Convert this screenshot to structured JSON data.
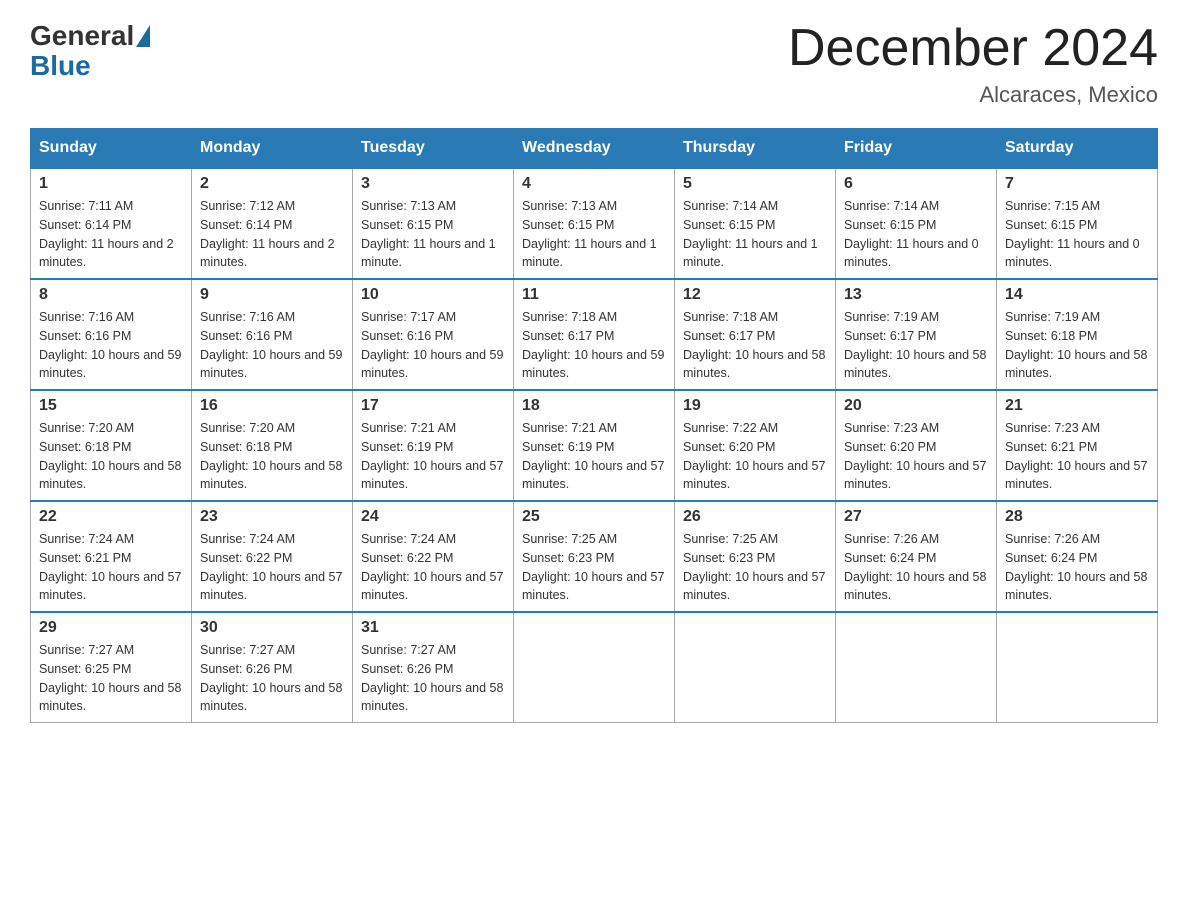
{
  "header": {
    "logo_general": "General",
    "logo_blue": "Blue",
    "month_title": "December 2024",
    "location": "Alcaraces, Mexico"
  },
  "days_of_week": [
    "Sunday",
    "Monday",
    "Tuesday",
    "Wednesday",
    "Thursday",
    "Friday",
    "Saturday"
  ],
  "weeks": [
    [
      {
        "day": "1",
        "sunrise": "7:11 AM",
        "sunset": "6:14 PM",
        "daylight": "11 hours and 2 minutes."
      },
      {
        "day": "2",
        "sunrise": "7:12 AM",
        "sunset": "6:14 PM",
        "daylight": "11 hours and 2 minutes."
      },
      {
        "day": "3",
        "sunrise": "7:13 AM",
        "sunset": "6:15 PM",
        "daylight": "11 hours and 1 minute."
      },
      {
        "day": "4",
        "sunrise": "7:13 AM",
        "sunset": "6:15 PM",
        "daylight": "11 hours and 1 minute."
      },
      {
        "day": "5",
        "sunrise": "7:14 AM",
        "sunset": "6:15 PM",
        "daylight": "11 hours and 1 minute."
      },
      {
        "day": "6",
        "sunrise": "7:14 AM",
        "sunset": "6:15 PM",
        "daylight": "11 hours and 0 minutes."
      },
      {
        "day": "7",
        "sunrise": "7:15 AM",
        "sunset": "6:15 PM",
        "daylight": "11 hours and 0 minutes."
      }
    ],
    [
      {
        "day": "8",
        "sunrise": "7:16 AM",
        "sunset": "6:16 PM",
        "daylight": "10 hours and 59 minutes."
      },
      {
        "day": "9",
        "sunrise": "7:16 AM",
        "sunset": "6:16 PM",
        "daylight": "10 hours and 59 minutes."
      },
      {
        "day": "10",
        "sunrise": "7:17 AM",
        "sunset": "6:16 PM",
        "daylight": "10 hours and 59 minutes."
      },
      {
        "day": "11",
        "sunrise": "7:18 AM",
        "sunset": "6:17 PM",
        "daylight": "10 hours and 59 minutes."
      },
      {
        "day": "12",
        "sunrise": "7:18 AM",
        "sunset": "6:17 PM",
        "daylight": "10 hours and 58 minutes."
      },
      {
        "day": "13",
        "sunrise": "7:19 AM",
        "sunset": "6:17 PM",
        "daylight": "10 hours and 58 minutes."
      },
      {
        "day": "14",
        "sunrise": "7:19 AM",
        "sunset": "6:18 PM",
        "daylight": "10 hours and 58 minutes."
      }
    ],
    [
      {
        "day": "15",
        "sunrise": "7:20 AM",
        "sunset": "6:18 PM",
        "daylight": "10 hours and 58 minutes."
      },
      {
        "day": "16",
        "sunrise": "7:20 AM",
        "sunset": "6:18 PM",
        "daylight": "10 hours and 58 minutes."
      },
      {
        "day": "17",
        "sunrise": "7:21 AM",
        "sunset": "6:19 PM",
        "daylight": "10 hours and 57 minutes."
      },
      {
        "day": "18",
        "sunrise": "7:21 AM",
        "sunset": "6:19 PM",
        "daylight": "10 hours and 57 minutes."
      },
      {
        "day": "19",
        "sunrise": "7:22 AM",
        "sunset": "6:20 PM",
        "daylight": "10 hours and 57 minutes."
      },
      {
        "day": "20",
        "sunrise": "7:23 AM",
        "sunset": "6:20 PM",
        "daylight": "10 hours and 57 minutes."
      },
      {
        "day": "21",
        "sunrise": "7:23 AM",
        "sunset": "6:21 PM",
        "daylight": "10 hours and 57 minutes."
      }
    ],
    [
      {
        "day": "22",
        "sunrise": "7:24 AM",
        "sunset": "6:21 PM",
        "daylight": "10 hours and 57 minutes."
      },
      {
        "day": "23",
        "sunrise": "7:24 AM",
        "sunset": "6:22 PM",
        "daylight": "10 hours and 57 minutes."
      },
      {
        "day": "24",
        "sunrise": "7:24 AM",
        "sunset": "6:22 PM",
        "daylight": "10 hours and 57 minutes."
      },
      {
        "day": "25",
        "sunrise": "7:25 AM",
        "sunset": "6:23 PM",
        "daylight": "10 hours and 57 minutes."
      },
      {
        "day": "26",
        "sunrise": "7:25 AM",
        "sunset": "6:23 PM",
        "daylight": "10 hours and 57 minutes."
      },
      {
        "day": "27",
        "sunrise": "7:26 AM",
        "sunset": "6:24 PM",
        "daylight": "10 hours and 58 minutes."
      },
      {
        "day": "28",
        "sunrise": "7:26 AM",
        "sunset": "6:24 PM",
        "daylight": "10 hours and 58 minutes."
      }
    ],
    [
      {
        "day": "29",
        "sunrise": "7:27 AM",
        "sunset": "6:25 PM",
        "daylight": "10 hours and 58 minutes."
      },
      {
        "day": "30",
        "sunrise": "7:27 AM",
        "sunset": "6:26 PM",
        "daylight": "10 hours and 58 minutes."
      },
      {
        "day": "31",
        "sunrise": "7:27 AM",
        "sunset": "6:26 PM",
        "daylight": "10 hours and 58 minutes."
      },
      null,
      null,
      null,
      null
    ]
  ]
}
